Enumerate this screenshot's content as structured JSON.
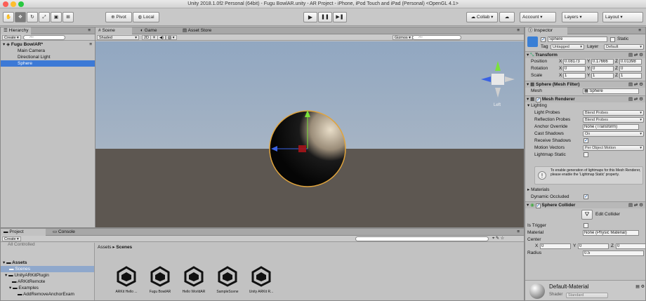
{
  "window": {
    "title": "Unity 2018.1.0f2 Personal (64bit) - Fugu BowlAR.unity - AR Project - iPhone, iPod Touch and iPad (Personal) <OpenGL 4.1>"
  },
  "toolbar": {
    "pivot": "Pivot",
    "local": "Local",
    "collab": "Collab",
    "account": "Account",
    "layers": "Layers",
    "layout": "Layout"
  },
  "hierarchy": {
    "tab": "Hierarchy",
    "create": "Create",
    "search_placeholder": "All",
    "scene": "Fugu BowlAR*",
    "items": [
      "Main Camera",
      "Directional Light",
      "Sphere"
    ]
  },
  "scene_view": {
    "tab_scene": "Scene",
    "tab_game": "Game",
    "tab_asset_store": "Asset Store",
    "shading": "Shaded",
    "mode_2d": "2D",
    "gizmos": "Gizmos",
    "search_placeholder": "All",
    "persp": "Left"
  },
  "project": {
    "tab_project": "Project",
    "tab_console": "Console",
    "create": "Create",
    "breadcrumb_root": "Assets",
    "breadcrumb_sep": "▸",
    "breadcrumb_leaf": "Scenes",
    "tree_partial": "All Controlled",
    "tree": [
      "Assets",
      "Scenes",
      "UnityARKitPlugin",
      "ARKitRemote",
      "Examples",
      "AddRemoveAnchorExam"
    ],
    "assets": [
      "ARKit Hello ...",
      "Fugu BowlAR",
      "Hello WorldAR",
      "SampleScene",
      "Unity ARKit R..."
    ]
  },
  "inspector": {
    "tab": "Inspector",
    "name": "Sphere",
    "static": "Static",
    "tag_label": "Tag",
    "tag": "Untagged",
    "layer_label": "Layer",
    "layer": "Default",
    "transform": {
      "title": "Transform",
      "position_label": "Position",
      "rotation_label": "Rotation",
      "scale_label": "Scale",
      "position": [
        "0.08173",
        "0.17666",
        "0.01398"
      ],
      "rotation": [
        "0",
        "0",
        "0"
      ],
      "scale": [
        "1",
        "1",
        "1"
      ]
    },
    "mesh_filter": {
      "title": "Sphere (Mesh Filter)",
      "mesh_label": "Mesh",
      "mesh": "Sphere"
    },
    "mesh_renderer": {
      "title": "Mesh Renderer",
      "lighting": "Lighting",
      "light_probes_label": "Light Probes",
      "light_probes": "Blend Probes",
      "reflection_label": "Reflection Probes",
      "reflection": "Blend Probes",
      "anchor_label": "Anchor Override",
      "anchor": "None (Transform)",
      "cast_label": "Cast Shadows",
      "cast": "On",
      "receive_label": "Receive Shadows",
      "motion_label": "Motion Vectors",
      "motion": "Per Object Motion",
      "lightmap_label": "Lightmap Static",
      "info": "To enable generation of lightmaps for this Mesh Renderer, please enable the 'Lightmap Static' property.",
      "materials": "Materials",
      "dynamic_label": "Dynamic Occluded"
    },
    "collider": {
      "title": "Sphere Collider",
      "edit": "Edit Collider",
      "trigger_label": "Is Trigger",
      "material_label": "Material",
      "material": "None (Physic Material)",
      "center_label": "Center",
      "center": [
        "0",
        "0",
        "0"
      ],
      "radius_label": "Radius",
      "radius": "0.5"
    },
    "material": {
      "name": "Default-Material",
      "shader_label": "Shader",
      "shader": "Standard"
    },
    "axes": [
      "X",
      "Y",
      "Z"
    ]
  }
}
